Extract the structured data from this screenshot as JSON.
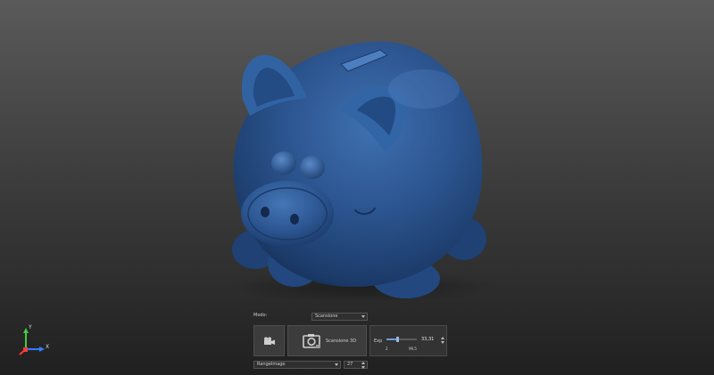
{
  "viewport": {
    "background_top": "#5a5a5a",
    "background_bottom": "#202020",
    "model_color": "#2c5590"
  },
  "axis_gizmo": {
    "x_label": "X",
    "y_label": "Y",
    "x_color": "#2e7dff",
    "y_color": "#3fcf3f",
    "z_color": "#ff3a3a"
  },
  "controls": {
    "mode_label": "Modo:",
    "mode_value": "Scansione",
    "camera_icon": "video-camera-icon",
    "scan_icon": "camera-icon",
    "scan_label": "Scansione 3D",
    "exposure": {
      "label": "Exp",
      "min": "2",
      "max": "99,5",
      "value": "33,31",
      "fill_fraction": 0.36
    },
    "view_value": "RangeImage",
    "count_value": "27"
  }
}
